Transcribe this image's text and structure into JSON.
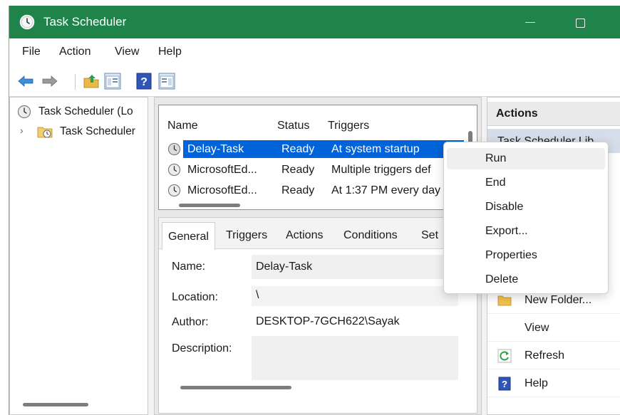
{
  "window": {
    "title": "Task Scheduler"
  },
  "menu": [
    "File",
    "Action",
    "View",
    "Help"
  ],
  "toolbar": {
    "icons": [
      "back-arrow-icon",
      "forward-arrow-icon",
      "folder-up-icon",
      "show-hide-console-tree-icon",
      "help-icon",
      "show-hide-action-pane-icon"
    ]
  },
  "tree": {
    "root": "Task Scheduler (Lo",
    "child": "Task Scheduler"
  },
  "task_list": {
    "columns": [
      "Name",
      "Status",
      "Triggers"
    ],
    "rows": [
      {
        "name": "Delay-Task",
        "status": "Ready",
        "trigger": "At system startup",
        "selected": true
      },
      {
        "name": "MicrosoftEd...",
        "status": "Ready",
        "trigger": "Multiple triggers def",
        "selected": false
      },
      {
        "name": "MicrosoftEd...",
        "status": "Ready",
        "trigger": "At 1:37 PM every day",
        "selected": false
      }
    ]
  },
  "detail": {
    "tabs": [
      "General",
      "Triggers",
      "Actions",
      "Conditions",
      "Set"
    ],
    "active_tab": "General",
    "name_label": "Name:",
    "name_value": "Delay-Task",
    "location_label": "Location:",
    "location_value": "\\",
    "author_label": "Author:",
    "author_value": "DESKTOP-7GCH622\\Sayak",
    "description_label": "Description:",
    "description_value": ""
  },
  "actions_pane": {
    "header": "Actions",
    "section": "Task Scheduler Lib",
    "items": [
      {
        "label": "New Folder...",
        "icon": "folder-icon"
      },
      {
        "label": "View",
        "icon": ""
      },
      {
        "label": "Refresh",
        "icon": "refresh-icon"
      },
      {
        "label": "Help",
        "icon": "help-icon"
      }
    ]
  },
  "context_menu": {
    "items": [
      "Run",
      "End",
      "Disable",
      "Export...",
      "Properties",
      "Delete"
    ],
    "hovered": "Run"
  },
  "colors": {
    "titlebar": "#1e8449",
    "selection": "#0063d9"
  }
}
